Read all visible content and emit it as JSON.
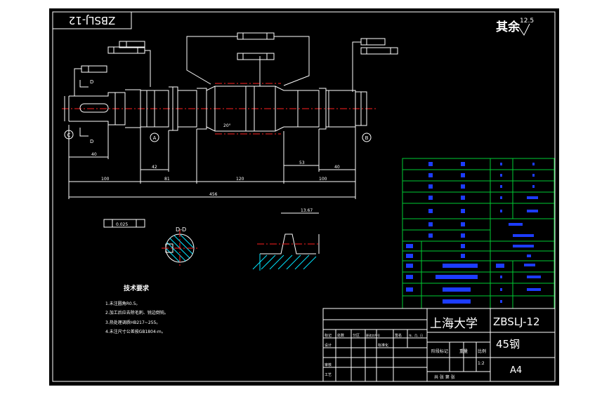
{
  "drawing": {
    "code_mirrored": "ZBSLJ-12",
    "roughness_label": "其余",
    "roughness_value": "12.5"
  },
  "title_block": {
    "school": "上海大学",
    "drawing_code": "ZBSLJ-12",
    "material": "45钢",
    "paper_size": "A4",
    "scale": "1:2",
    "revision_headers": [
      "标记",
      "处数",
      "分区",
      "更改文件号",
      "签名",
      "年、月、日"
    ],
    "approval_rows": [
      "设计",
      "",
      "审核",
      "",
      "工艺"
    ],
    "stage_headers": [
      "阶段标记",
      "重量",
      "比例"
    ],
    "sheet_footer": "共  张  第  张",
    "designer_date": "标准化"
  },
  "section_label": "D-D",
  "tech_requirements": {
    "title": "技术要求",
    "items": [
      "1.未注圆角R0.5。",
      "2.加工后应去除毛刺、锐边倒钝。",
      "3.热处理调质HB217~255。",
      "4.未注尺寸公差按GB1804-m。"
    ]
  },
  "dimensions": {
    "total_length": "456",
    "seg_left": "100",
    "seg_mid_left": "81",
    "seg_center": "120",
    "seg_right": "100",
    "key_len": "40",
    "bearing_len": "42",
    "right_len": "40",
    "gear_len": "53",
    "angle": "20°",
    "tolerance_d": "0.025",
    "key_depth": "5",
    "tooth_dim": "13.67"
  },
  "datums": {
    "a": "A",
    "b": "B",
    "c": "C"
  },
  "gear_table": {
    "rows": 13
  }
}
